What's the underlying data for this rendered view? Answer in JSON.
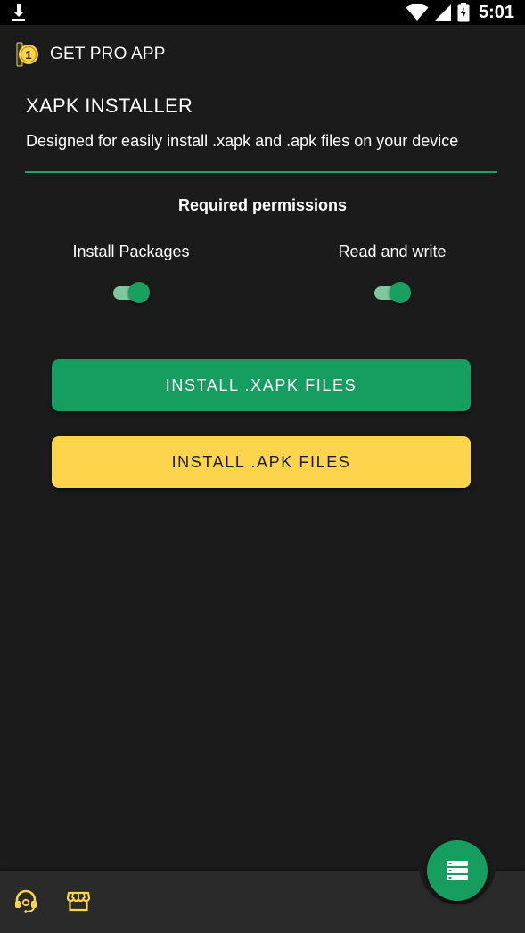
{
  "status_bar": {
    "time": "5:01",
    "icons": [
      "download-icon",
      "wifi-icon",
      "signal-icon",
      "battery-icon"
    ]
  },
  "header": {
    "pro_label": "GET PRO APP",
    "pro_badge": "1"
  },
  "app": {
    "title": "XAPK INSTALLER",
    "subtitle": "Designed for easily install .xapk and .apk files on your device"
  },
  "permissions": {
    "heading": "Required permissions",
    "items": [
      {
        "label": "Install Packages",
        "enabled": true
      },
      {
        "label": "Read and write",
        "enabled": true
      }
    ]
  },
  "buttons": {
    "install_xapk": "INSTALL .XAPK FILES",
    "install_apk": "INSTALL .APK FILES"
  },
  "bottom_bar": {
    "icons": [
      "support-headset-icon",
      "store-icon"
    ],
    "fab_icon": "server-list-icon"
  },
  "colors": {
    "accent_green": "#159e5f",
    "accent_yellow": "#fdd54c",
    "background": "#1b1b1b",
    "toggle_track": "#7fc79e"
  }
}
